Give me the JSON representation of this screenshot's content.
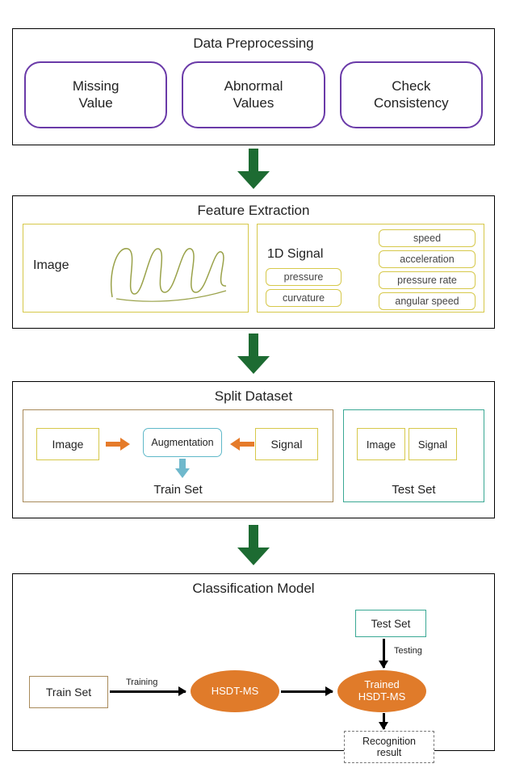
{
  "stages": {
    "preproc": {
      "title": "Data Preprocessing",
      "items": [
        "Missing\nValue",
        "Abnormal\nValues",
        "Check\nConsistency"
      ]
    },
    "feature": {
      "title": "Feature Extraction",
      "image_label": "Image",
      "signal_label": "1D Signal",
      "signal_left": [
        "pressure",
        "curvature"
      ],
      "signal_right": [
        "speed",
        "acceleration",
        "pressure rate",
        "angular speed"
      ]
    },
    "split": {
      "title": "Split Dataset",
      "train": {
        "image": "Image",
        "augmentation": "Augmentation",
        "signal": "Signal",
        "caption": "Train Set"
      },
      "test": {
        "image": "Image",
        "signal": "Signal",
        "caption": "Test Set"
      }
    },
    "model": {
      "title": "Classification Model",
      "trainset": "Train Set",
      "training_label": "Training",
      "hsdt": "HSDT-MS",
      "trained_hsdt": "Trained\nHSDT-MS",
      "testset": "Test Set",
      "testing_label": "Testing",
      "result": "Recognition\nresult"
    }
  }
}
